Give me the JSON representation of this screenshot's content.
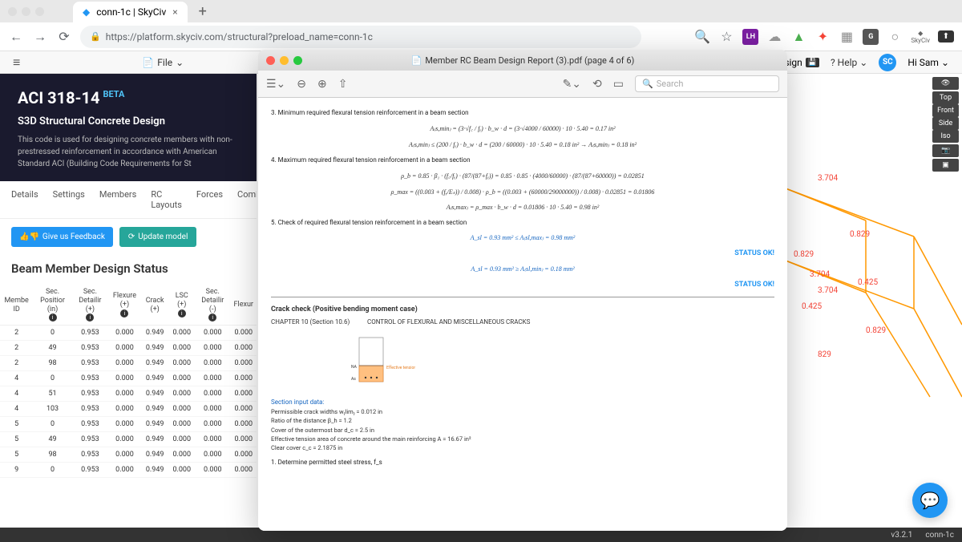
{
  "browser": {
    "tab_title": "conn-1c | SkyCiv",
    "url": "https://platform.skyciv.com/structural?preload_name=conn-1c",
    "ext_badge": "LH",
    "ext_g": "G",
    "skyciv_ext": "SkyCiv"
  },
  "app_header": {
    "file": "File",
    "design": "Design",
    "help": "Help",
    "user_badge": "SC",
    "user_greeting": "Hi Sam"
  },
  "banner": {
    "title": "ACI 318-14",
    "beta": "BETA",
    "subtitle": "S3D Structural Concrete Design",
    "desc": "This code is used for designing concrete members with non-prestressed reinforcement in accordance with American Standard ACI (Building Code Requirements for St"
  },
  "panel": {
    "tabs": [
      "Details",
      "Settings",
      "Members",
      "RC Layouts",
      "Forces",
      "Combi"
    ],
    "feedback_btn": "Give us Feedback",
    "update_btn": "Update model",
    "title": "Beam Member Design Status",
    "headers": {
      "member_id": "Membe ID",
      "sec_pos": "Sec. Positior (in)",
      "sec_det": "Sec. Detailir (+)",
      "flexure": "Flexure (+)",
      "crack": "Crack (+)",
      "lsc": "LSC (+)",
      "sec_det2": "Sec. Detailir (-)",
      "flexur2": "Flexur"
    },
    "rows": [
      {
        "id": "2",
        "pos": "0",
        "v": [
          "0.953",
          "0.000",
          "0.949",
          "0.000",
          "0.000",
          "0.000"
        ]
      },
      {
        "id": "2",
        "pos": "49",
        "v": [
          "0.953",
          "0.000",
          "0.949",
          "0.000",
          "0.000",
          "0.000"
        ]
      },
      {
        "id": "2",
        "pos": "98",
        "v": [
          "0.953",
          "0.000",
          "0.949",
          "0.000",
          "0.000",
          "0.000"
        ]
      },
      {
        "id": "4",
        "pos": "0",
        "v": [
          "0.953",
          "0.000",
          "0.949",
          "0.000",
          "0.000",
          "0.000"
        ]
      },
      {
        "id": "4",
        "pos": "51",
        "v": [
          "0.953",
          "0.000",
          "0.949",
          "0.000",
          "0.000",
          "0.000"
        ]
      },
      {
        "id": "4",
        "pos": "103",
        "v": [
          "0.953",
          "0.000",
          "0.949",
          "0.000",
          "0.000",
          "0.000"
        ]
      },
      {
        "id": "5",
        "pos": "0",
        "v": [
          "0.953",
          "0.000",
          "0.949",
          "0.000",
          "0.000",
          "0.000"
        ]
      },
      {
        "id": "5",
        "pos": "49",
        "v": [
          "0.953",
          "0.000",
          "0.949",
          "0.000",
          "0.000",
          "0.000"
        ]
      },
      {
        "id": "5",
        "pos": "98",
        "v": [
          "0.953",
          "0.000",
          "0.949",
          "0.000",
          "0.000",
          "0.000"
        ]
      },
      {
        "id": "9",
        "pos": "0",
        "v": [
          "0.953",
          "0.000",
          "0.949",
          "0.000",
          "0.000",
          "0.000"
        ]
      }
    ]
  },
  "view3d": {
    "buttons": [
      "Top",
      "Front",
      "Side",
      "Iso"
    ],
    "labels": [
      "3.704",
      "0.829",
      "0.829",
      "3.704",
      "3.704",
      "0.425",
      "0.425",
      "0.829",
      "829"
    ]
  },
  "pdf": {
    "title": "Member RC Beam Design Report (3).pdf (page 4 of 6)",
    "search_placeholder": "Search",
    "sec3": "3. Minimum required flexural tension reinforcement in a beam section",
    "eq3a": "A₍s,min₎ = (3·√f꜀ / fᵧ) · b_w · d = (3·√4000 / 60000) · 10 · 5.40 = 0.17 in²",
    "eq3b": "A₍s,min₎ ≤ (200 / fᵧ) · b_w · d = (200 / 60000) · 10 · 5.40 = 0.18 in² → A₍s,min₎ = 0.18 in²",
    "sec4": "4. Maximum required flexural tension reinforcement in a beam section",
    "eq4a": "ρ_b = 0.85 · β₁ · (f꜀/fᵧ) · (87/(87+fᵧ)) = 0.85 · 0.85 · (4000/60000) · (87/(87+60000)) = 0.02851",
    "eq4b": "ρ_max = ((0.003 + (fᵧ/Eₛ)) / 0.008) · ρ_b = ((0.003 + (60000/29000000)) / 0.008) · 0.02851 = 0.01806",
    "eq4c": "A₍s,max₎ = ρ_max · b_w · d = 0.01806 · 10 · 5.40 = 0.98 in²",
    "sec5": "5. Check of required flexural tension reinforcement in a beam section",
    "eq5a": "A_sl = 0.93 mm² ≤ A₍sl,max₎ = 0.98 mm²",
    "eq5b": "A_sl = 0.93 mm² ≥ A₍sl,min₎ = 0.18 mm²",
    "status": "STATUS OK!",
    "crack_title": "Crack check (Positive bending moment case)",
    "chapter": "CHAPTER 10 (Section 10.6)",
    "chapter_desc": "CONTROL OF FLEXURAL AND MISCELLANEOUS CRACKS",
    "diagram_na": "NA",
    "diagram_as": "As",
    "diagram_eff": "Effective tension area A",
    "input_title": "Section input data:",
    "input1": "Permissible crack widths w₍lim₎ = 0.012  in",
    "input2": "Ratio of the distance β_h = 1.2",
    "input3": "Cover of the outermost bar d_c = 2.5  in",
    "input4": "Effective tension area of concrete around the main reinforcing A = 16.67  in²",
    "input5": "Clear cover c_c = 2.1875  in",
    "step1": "1. Determine permitted steel stress, f_s"
  },
  "status_bar": {
    "version": "v3.2.1",
    "project": "conn-1c"
  }
}
